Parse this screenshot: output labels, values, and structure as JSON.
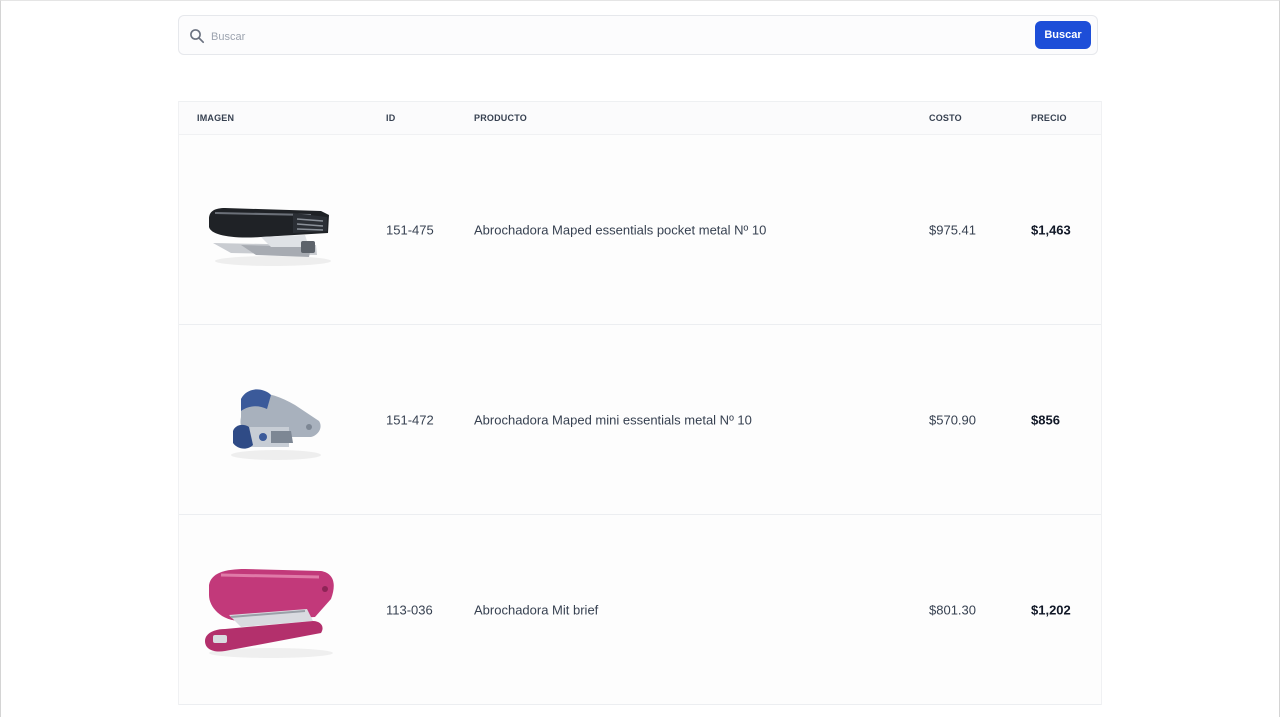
{
  "search": {
    "placeholder": "Buscar",
    "value": "",
    "button_label": "Buscar",
    "icon": "search-icon"
  },
  "table": {
    "headers": [
      "IMAGEN",
      "ID",
      "PRODUCTO",
      "COSTO",
      "PRECIO"
    ],
    "rows": [
      {
        "image_icon": "stapler-black-icon",
        "id": "151-475",
        "product": "Abrochadora Maped essentials pocket metal Nº 10",
        "cost": "$975.41",
        "price": "$1,463"
      },
      {
        "image_icon": "stapler-blue-icon",
        "id": "151-472",
        "product": "Abrochadora Maped mini essentials metal Nº 10",
        "cost": "$570.90",
        "price": "$856"
      },
      {
        "image_icon": "stapler-pink-icon",
        "id": "113-036",
        "product": "Abrochadora Mit brief",
        "cost": "$801.30",
        "price": "$1,202"
      }
    ]
  },
  "colors": {
    "accent": "#1d4ed8",
    "stapler_black": "#1f2226",
    "stapler_blue": "#3b5a9a",
    "stapler_pink": "#c2397a"
  }
}
